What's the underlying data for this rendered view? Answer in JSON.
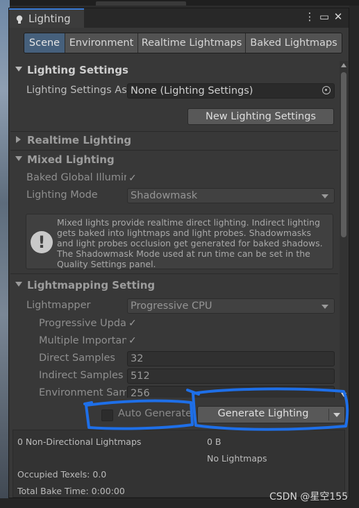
{
  "window": {
    "title": "Lighting",
    "controls": [
      {
        "icon": "kebab-menu-icon",
        "glyph": "⋮"
      },
      {
        "icon": "maximize-icon",
        "glyph": "▭"
      },
      {
        "icon": "close-icon",
        "glyph": "✕"
      }
    ]
  },
  "tabs": [
    {
      "label": "Scene",
      "active": true
    },
    {
      "label": "Environment",
      "active": false
    },
    {
      "label": "Realtime Lightmaps",
      "active": false
    },
    {
      "label": "Baked Lightmaps",
      "active": false
    }
  ],
  "sections": {
    "lighting_settings": {
      "title": "Lighting Settings",
      "asset_label": "Lighting Settings As",
      "asset_value": "None (Lighting Settings)",
      "new_button": "New Lighting Settings"
    },
    "realtime_lighting": {
      "title": "Realtime Lighting"
    },
    "mixed_lighting": {
      "title": "Mixed Lighting",
      "baked_gi_label": "Baked Global Illumin",
      "baked_gi_checked": true,
      "lighting_mode_label": "Lighting Mode",
      "lighting_mode_value": "Shadowmask",
      "help_text": "Mixed lights provide realtime direct lighting. Indirect lighting gets baked into lightmaps and light probes. Shadowmasks and light probes occlusion get generated for baked shadows. The Shadowmask Mode used at run time can be set in the Quality Settings panel."
    },
    "lightmapping": {
      "title": "Lightmapping Setting",
      "lightmapper_label": "Lightmapper",
      "lightmapper_value": "Progressive CPU",
      "progressive_updates_label": "Progressive Upda",
      "progressive_updates_checked": true,
      "multiple_importance_label": "Multiple Importan",
      "multiple_importance_checked": true,
      "direct_samples_label": "Direct Samples",
      "direct_samples_value": "32",
      "indirect_samples_label": "Indirect Samples",
      "indirect_samples_value": "512",
      "environment_samples_label": "Environment Sam",
      "environment_samples_value": "256"
    }
  },
  "footer": {
    "auto_generate_label": "Auto Generate",
    "auto_generate_checked": false,
    "generate_button": "Generate Lighting"
  },
  "stats": {
    "non_directional": "0 Non-Directional Lightmaps",
    "size": "0 B",
    "no_lightmaps": "No Lightmaps",
    "occupied_texels": "Occupied Texels: 0.0",
    "total_bake_time": "Total Bake Time: 0:00:00"
  },
  "watermark": "CSDN @星空155",
  "colors": {
    "accent_tab": "#46607c",
    "annotation_stroke": "#1e6fe8",
    "panel_bg": "#383838"
  }
}
